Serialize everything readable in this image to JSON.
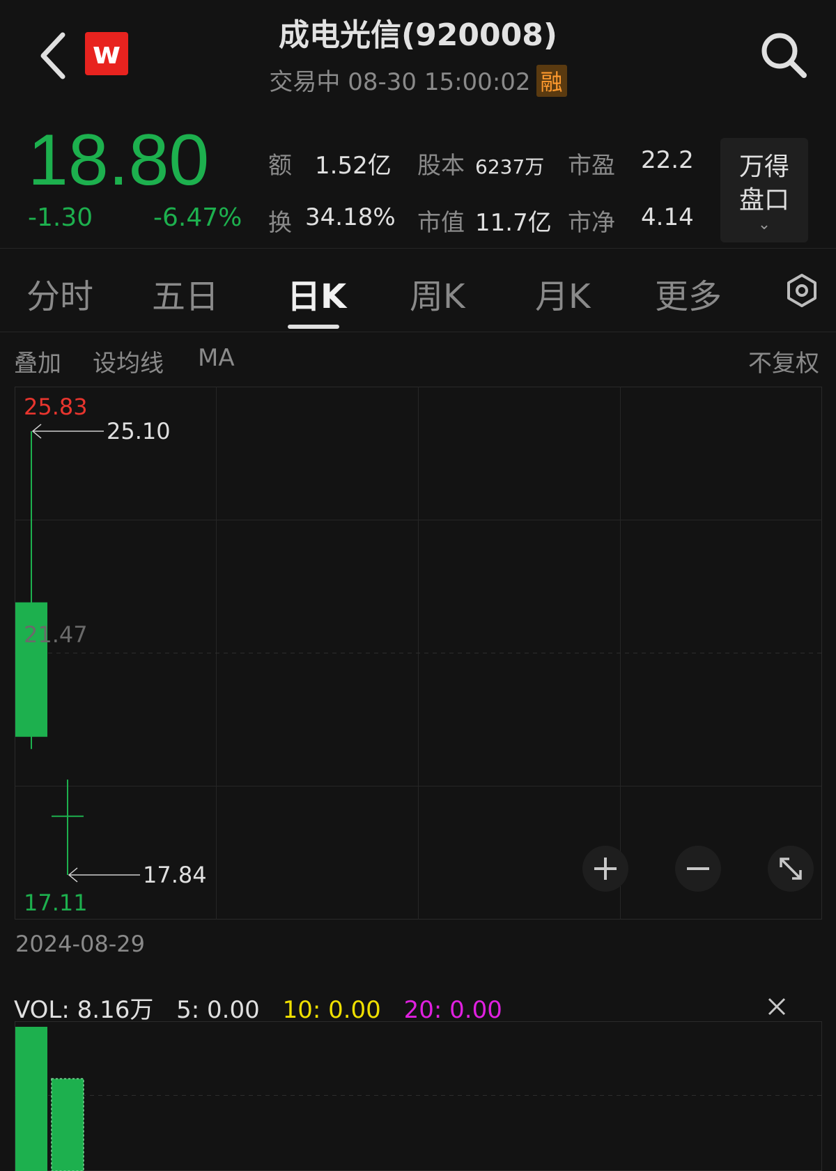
{
  "header": {
    "title": "成电光信(920008)",
    "status": "交易中 08-30 15:00:02",
    "badge": "融",
    "logo_letter": "w",
    "brand_color": "#e8231f"
  },
  "quote": {
    "price": "18.80",
    "change": "-1.30",
    "change_pct": "-6.47%",
    "down_color": "#1db04e",
    "stats": [
      {
        "label": "额",
        "value": "1.52亿"
      },
      {
        "label": "股本",
        "value": "6237万"
      },
      {
        "label": "市盈",
        "value": "22.2"
      },
      {
        "label": "换",
        "value": "34.18%"
      },
      {
        "label": "市值",
        "value": "11.7亿"
      },
      {
        "label": "市净",
        "value": "4.14"
      }
    ],
    "pankou_line1": "万得",
    "pankou_line2": "盘口"
  },
  "tabs": [
    {
      "label": "分时"
    },
    {
      "label": "五日"
    },
    {
      "label": "日K"
    },
    {
      "label": "周K"
    },
    {
      "label": "月K"
    },
    {
      "label": "更多"
    }
  ],
  "active_tab": 2,
  "toolbar": {
    "overlay": "叠加",
    "set_ma": "设均线",
    "ma": "MA",
    "adjust": "不复权"
  },
  "chart_data": {
    "type": "candlestick",
    "y_max_label": "25.83",
    "y_mid_label": "21.47",
    "y_min_label": "17.11",
    "ylim": [
      17.11,
      25.83
    ],
    "high_marker": "25.10",
    "low_marker": "17.84",
    "up_color": "#e8352e",
    "down_color": "#1db04e",
    "candles": [
      {
        "open": 22.3,
        "close": 20.1,
        "high": 25.1,
        "low": 19.9
      },
      {
        "open": 18.8,
        "close": 18.8,
        "high": 19.4,
        "low": 17.84
      }
    ],
    "date_label": "2024-08-29",
    "volume": {
      "label": "VOL: 8.16万",
      "ma5": "5: 0.00",
      "ma10": "10: 0.00",
      "ma20": "20: 0.00",
      "ma10_color": "#f0e000",
      "ma20_color": "#e020e0",
      "values": [
        10.0,
        6.4
      ],
      "max": 10.0
    }
  }
}
